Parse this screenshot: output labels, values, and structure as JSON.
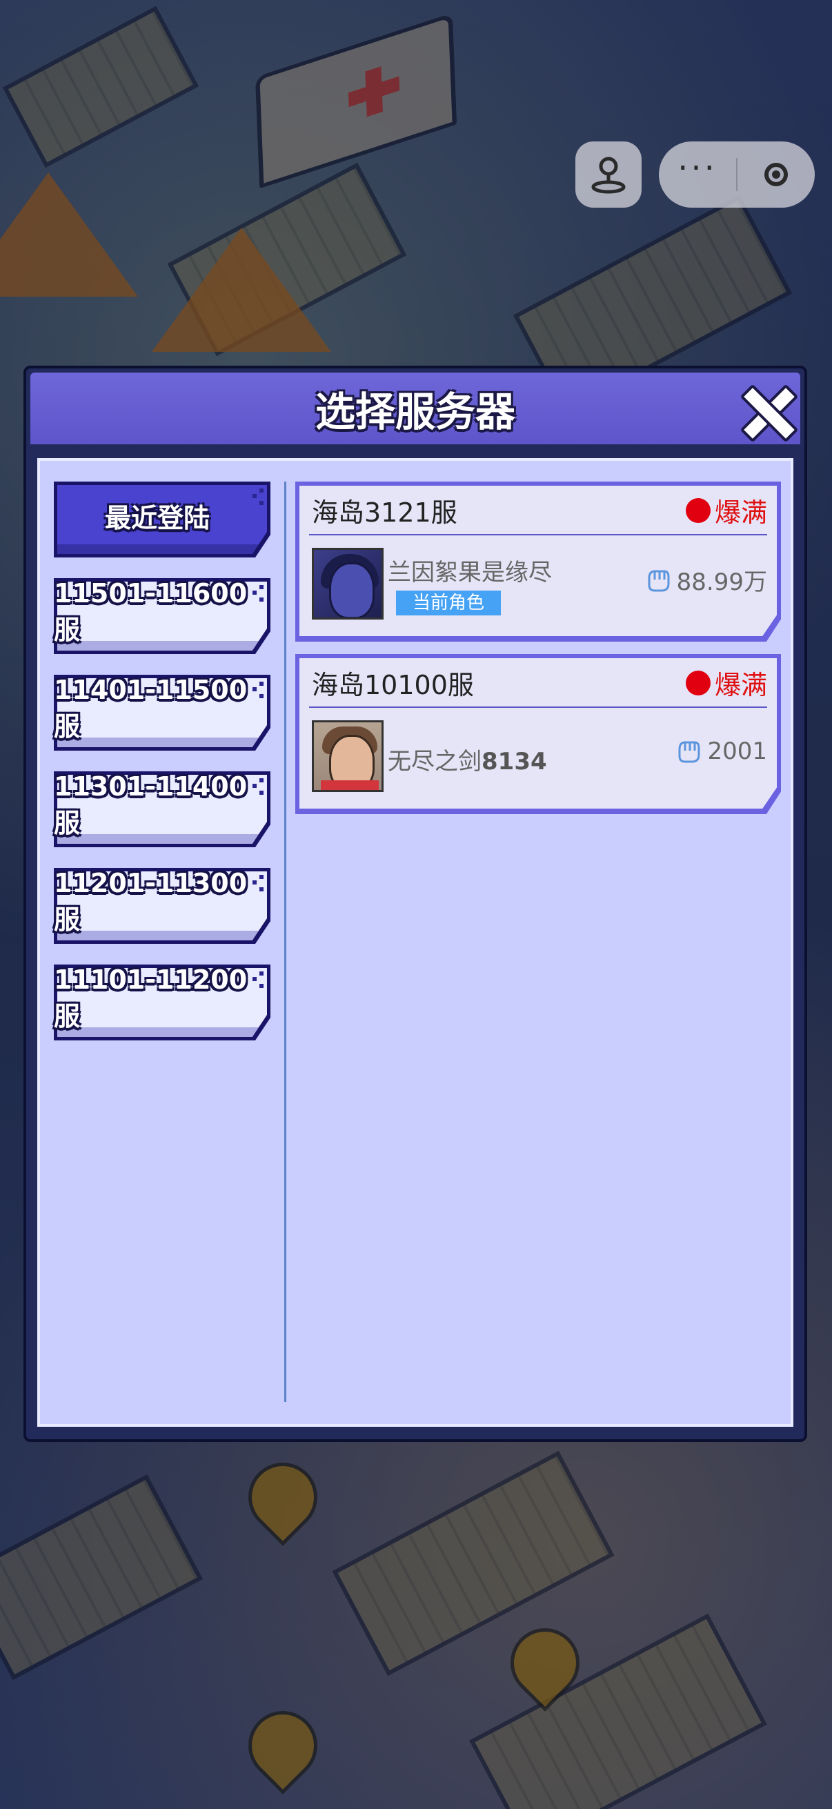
{
  "dialog": {
    "title": "选择服务器"
  },
  "tabs": [
    {
      "label": "最近登陆",
      "active": true
    },
    {
      "label": "11501-11600服",
      "active": false
    },
    {
      "label": "11401-11500服",
      "active": false
    },
    {
      "label": "11301-11400服",
      "active": false
    },
    {
      "label": "11201-11300服",
      "active": false
    },
    {
      "label": "11101-11200服",
      "active": false
    }
  ],
  "servers": [
    {
      "name": "海岛3121服",
      "status": "爆满",
      "role_name": "兰因絮果是缘尽",
      "badge": "当前角色",
      "power": "88.99万"
    },
    {
      "name": "海岛10100服",
      "status": "爆满",
      "role_name_prefix": "无尽之剑",
      "role_name_number": "8134",
      "power": "2001"
    }
  ],
  "colors": {
    "header": "#5d55c9",
    "panel": "#c9ceff",
    "status_full": "#e01010",
    "badge": "#45a2f4"
  }
}
